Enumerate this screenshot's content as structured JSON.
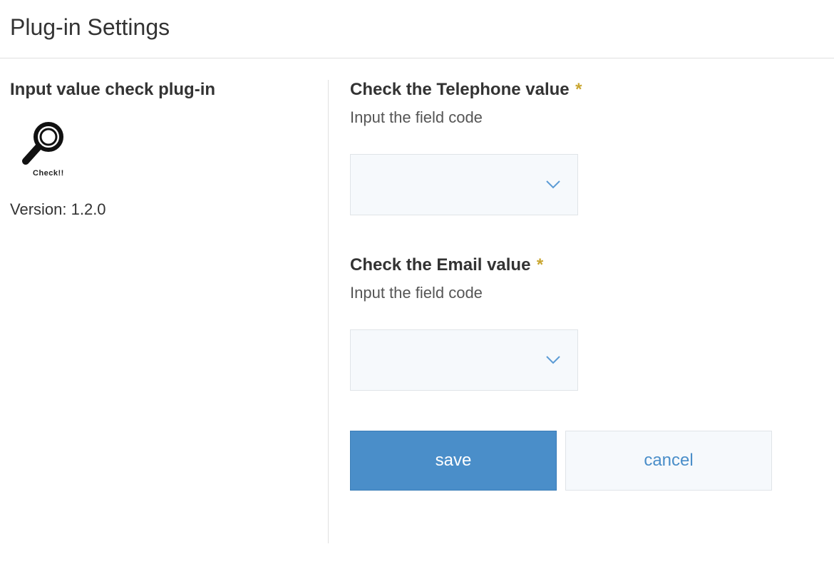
{
  "header": {
    "title": "Plug-in Settings"
  },
  "left": {
    "plugin_name": "Input value check plug-in",
    "icon_text": "Check!!",
    "version_label": "Version: 1.2.0"
  },
  "fields": {
    "telephone": {
      "label": "Check the Telephone value",
      "required_mark": "*",
      "hint": "Input the field code",
      "selected": ""
    },
    "email": {
      "label": "Check the Email value",
      "required_mark": "*",
      "hint": "Input the field code",
      "selected": ""
    }
  },
  "buttons": {
    "save": "save",
    "cancel": "cancel"
  }
}
